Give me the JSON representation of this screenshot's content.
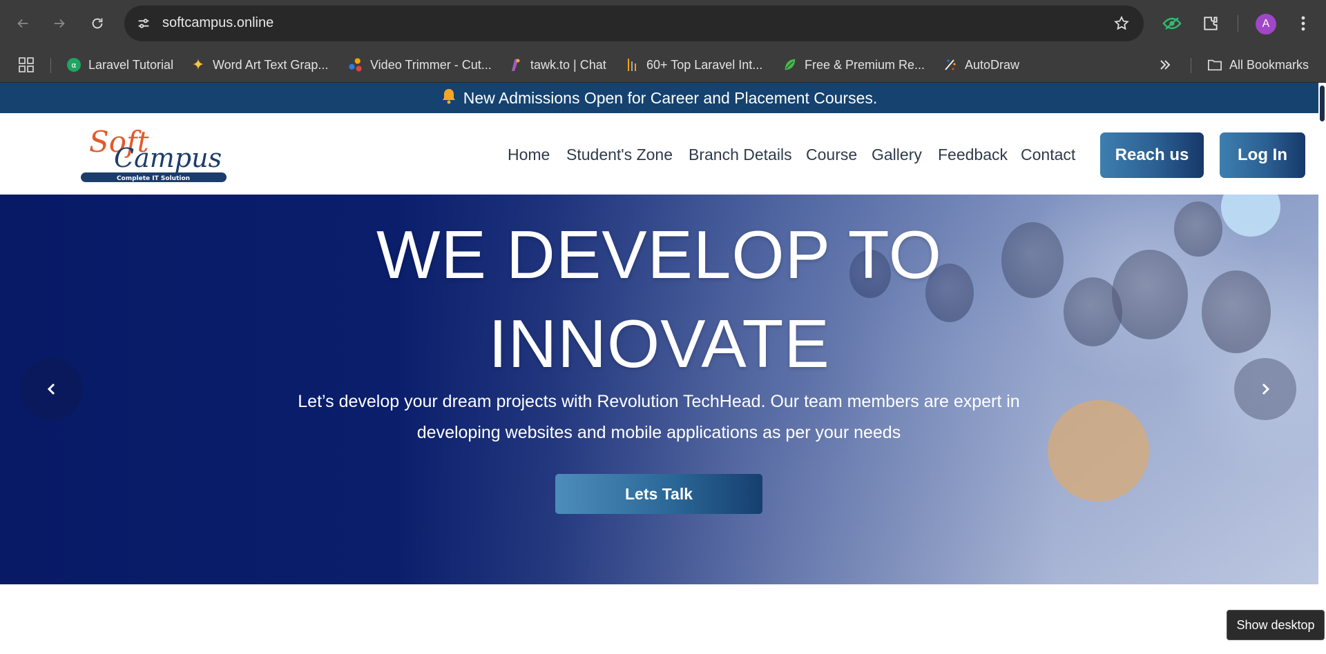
{
  "browser": {
    "url": "softcampus.online",
    "profile_initial": "A",
    "bookmarks": [
      {
        "label": "Laravel Tutorial",
        "icon": "laravel-icon"
      },
      {
        "label": "Word Art Text Grap...",
        "icon": "sparkle-icon"
      },
      {
        "label": "Video Trimmer - Cut...",
        "icon": "dots-icon"
      },
      {
        "label": "tawk.to | Chat",
        "icon": "chat-icon"
      },
      {
        "label": "60+ Top Laravel Int...",
        "icon": "bars-icon"
      },
      {
        "label": "Free & Premium Re...",
        "icon": "leaf-icon"
      },
      {
        "label": "AutoDraw",
        "icon": "pencil-icon"
      }
    ],
    "all_bookmarks": "All Bookmarks"
  },
  "site": {
    "announcement": "New Admissions Open for Career and Placement Courses.",
    "logo_text": {
      "soft": "Soft",
      "campus": "Campus",
      "tagline": "Complete IT Solution"
    },
    "menu": [
      "Home",
      "Student's Zone",
      "Branch Details",
      "Course",
      "Gallery",
      "Feedback",
      "Contact"
    ],
    "reach_us": "Reach us",
    "log_in": "Log In",
    "hero": {
      "title_line1": "WE DEVELOP TO",
      "title_line2": "INNOVATE",
      "subtitle_line1": "Let’s develop your dream projects with Revolution TechHead. Our team members are expert in",
      "subtitle_line2": "developing websites and mobile applications as per your needs",
      "cta": "Lets Talk"
    }
  },
  "os": {
    "tooltip": "Show desktop"
  },
  "colors": {
    "announce_bg": "#15426f",
    "hero_bg": "#071a63",
    "accent": "#2b5f92",
    "chrome": "#3c3c3c"
  }
}
